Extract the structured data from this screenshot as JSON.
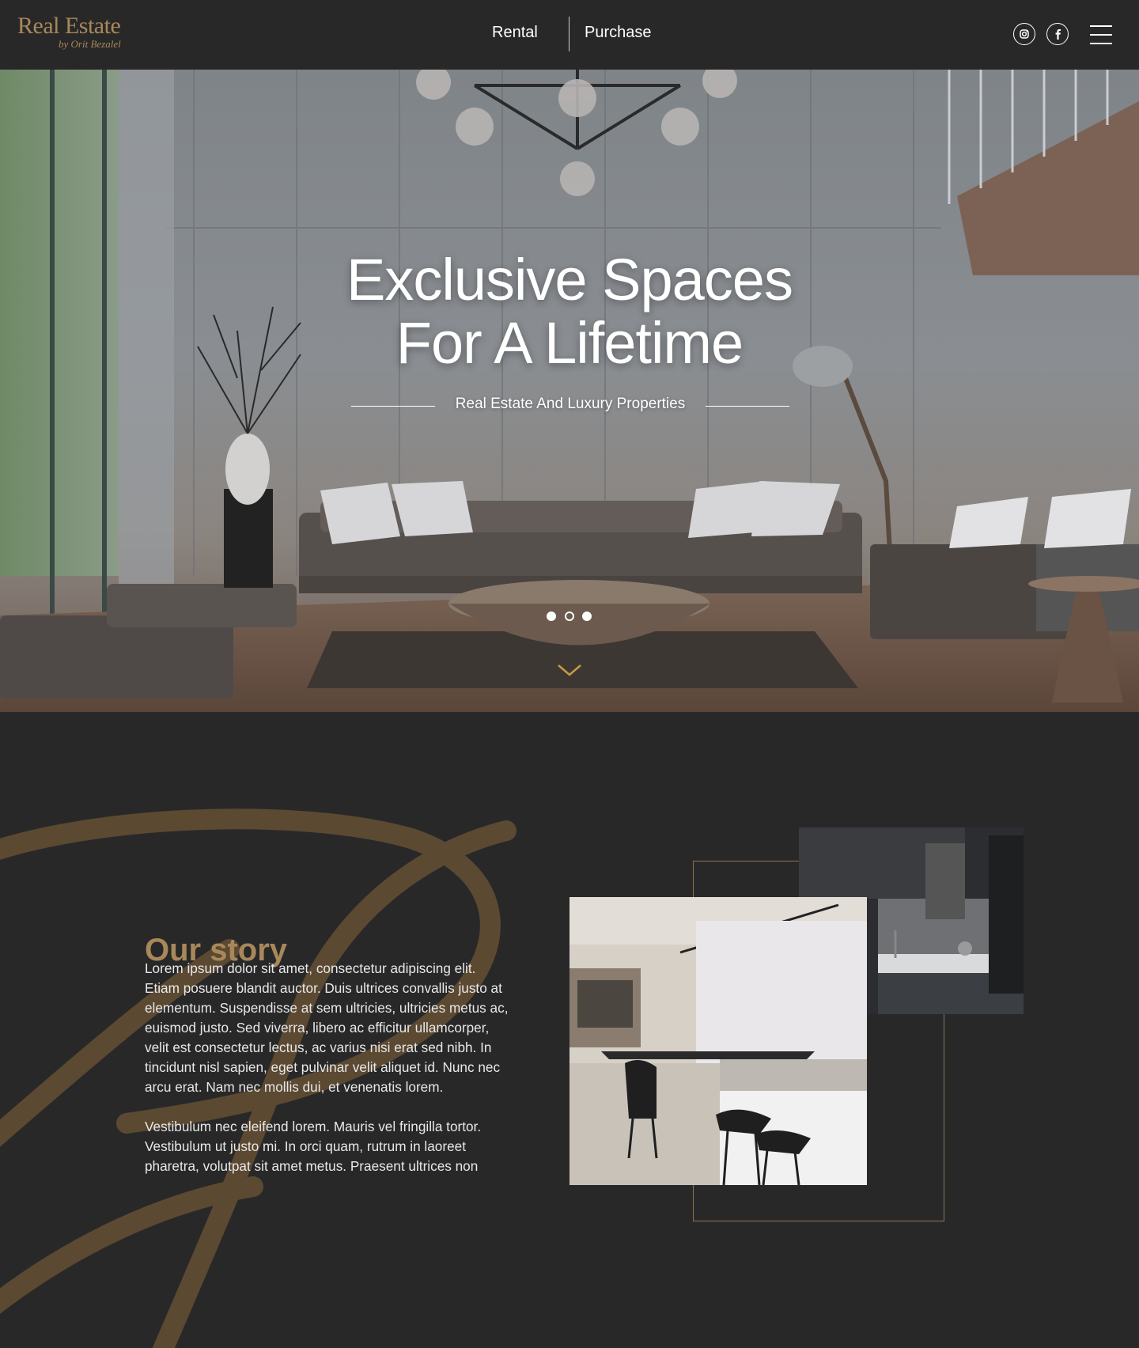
{
  "header": {
    "logo_text": "Real Estate",
    "logo_subtitle": "by Orit Bezalel",
    "nav": [
      {
        "label": "Rental"
      },
      {
        "label": "Purchase"
      }
    ],
    "social": [
      "instagram-icon",
      "facebook-icon"
    ],
    "menu_icon": "hamburger-menu-icon"
  },
  "hero": {
    "title_line1": "Exclusive Spaces",
    "title_line2": "For A Lifetime",
    "subtitle": "Real Estate And Luxury Properties",
    "slides": {
      "count": 3,
      "active_index": 1
    },
    "scroll_icon": "chevron-down-icon"
  },
  "story": {
    "heading": "Our story",
    "paragraphs": [
      "Lorem ipsum dolor sit amet, consectetur adipiscing elit. Etiam posuere blandit auctor. Duis ultrices convallis justo at elementum. Suspendisse at sem ultricies, ultricies metus ac, euismod justo. Sed viverra, libero ac efficitur ullamcorper, velit est consectetur lectus, ac varius nisi erat sed nibh. In tincidunt nisl sapien, eget pulvinar velit aliquet id. Nunc nec arcu erat. Nam nec mollis dui, et venenatis lorem.",
      "Vestibulum nec eleifend lorem. Mauris vel fringilla tortor. Vestibulum ut justo mi. In orci quam, rutrum in laoreet pharetra, volutpat sit amet metus. Praesent ultrices non"
    ]
  },
  "colors": {
    "background": "#292829",
    "accent_gold": "#a8885a",
    "text": "#ffffff"
  }
}
